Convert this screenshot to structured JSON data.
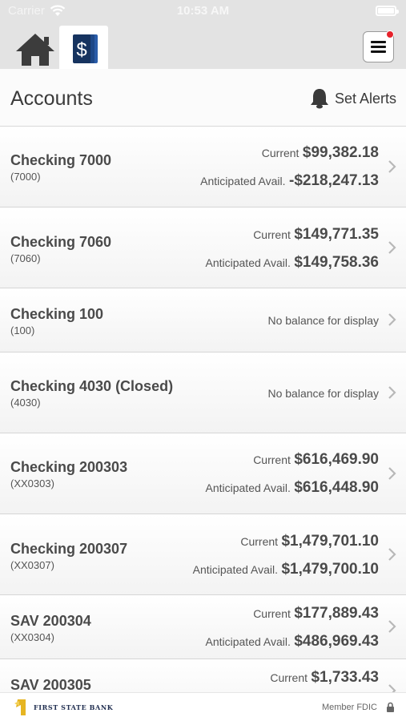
{
  "status_bar": {
    "carrier": "Carrier",
    "time": "10:53 AM"
  },
  "tabs": {
    "home_icon": "home-icon",
    "accounts_icon": "dollar-cards-icon",
    "menu_icon": "hamburger-menu-icon"
  },
  "header": {
    "title": "Accounts",
    "alerts_label": "Set Alerts",
    "alerts_icon": "bell-icon"
  },
  "accounts": [
    {
      "name": "Checking 7000",
      "number": "(7000)",
      "current_label": "Current",
      "current": "$99,382.18",
      "anticipated_label": "Anticipated Avail.",
      "anticipated": "-$218,247.13"
    },
    {
      "name": "Checking 7060",
      "number": "(7060)",
      "current_label": "Current",
      "current": "$149,771.35",
      "anticipated_label": "Anticipated Avail.",
      "anticipated": "$149,758.36"
    },
    {
      "name": "Checking 100",
      "number": "(100)",
      "no_balance": "No balance for display"
    },
    {
      "name": "Checking 4030 (Closed)",
      "number": "(4030)",
      "no_balance": "No balance for display"
    },
    {
      "name": "Checking 200303",
      "number": "(XX0303)",
      "current_label": "Current",
      "current": "$616,469.90",
      "anticipated_label": "Anticipated Avail.",
      "anticipated": "$616,448.90"
    },
    {
      "name": "Checking 200307",
      "number": "(XX0307)",
      "current_label": "Current",
      "current": "$1,479,701.10",
      "anticipated_label": "Anticipated Avail.",
      "anticipated": "$1,479,700.10"
    },
    {
      "name": "SAV 200304",
      "number": "(XX0304)",
      "current_label": "Current",
      "current": "$177,889.43",
      "anticipated_label": "Anticipated Avail.",
      "anticipated": "$486,969.43"
    },
    {
      "name": "SAV 200305",
      "current_label": "Current",
      "current": "$1,733.43"
    }
  ],
  "footer": {
    "bank_name": "FIRST STATE BANK",
    "member_fdic": "Member FDIC",
    "lock_icon": "lock-icon"
  },
  "colors": {
    "menu_badge": "#e6222b",
    "accounts_tab": "#16335f"
  }
}
